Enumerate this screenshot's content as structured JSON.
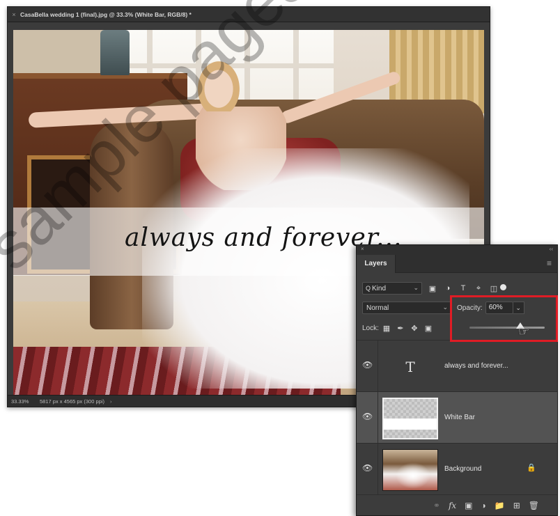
{
  "document": {
    "close_glyph": "×",
    "title": "CasaBella wedding 1 (final).jpg @ 33.3% (White Bar, RGB/8) *",
    "canvas_text": "always and forever...",
    "status": {
      "zoom": "33.33%",
      "info": "5817 px x 4565 px (300 ppi)",
      "arrow": "›"
    }
  },
  "watermark": "sample pages",
  "layers_panel": {
    "close_glyph": "×",
    "collapse_glyph": "‹‹",
    "tab_label": "Layers",
    "menu_glyph": "≡",
    "filter": {
      "kind_label": "Kind",
      "search_glyph": "Q",
      "chevron": "⌄"
    },
    "blend_mode": "Normal",
    "opacity_label": "Opacity:",
    "opacity_value": "60%",
    "opacity_fraction": 0.6,
    "lock_label": "Lock:",
    "layers": [
      {
        "name": "always and forever...",
        "type": "text",
        "thumb_glyph": "T",
        "visible": true
      },
      {
        "name": "White Bar",
        "type": "pixel",
        "visible": true,
        "selected": true
      },
      {
        "name": "Background",
        "type": "photo",
        "visible": true,
        "locked": true
      }
    ]
  },
  "colors": {
    "highlight": "#e01c25",
    "panel_bg": "#3c3c3c",
    "selected_row": "#535353"
  }
}
